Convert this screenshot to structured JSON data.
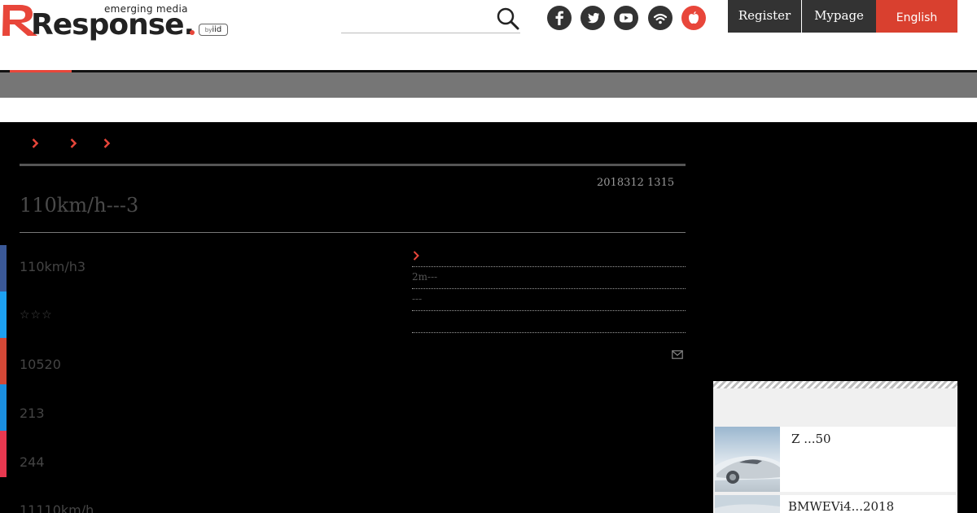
{
  "header": {
    "logo_text": "Response.",
    "logo_tagline": "emerging media",
    "logo_byline_by": "by",
    "logo_byline_brand": "iid",
    "search_placeholder": "",
    "social_icons": [
      "facebook-icon",
      "twitter-icon",
      "youtube-icon",
      "rss-icon",
      "apple-icon"
    ],
    "register_label": "Register",
    "mypage_label": "Mypage",
    "english_label": "English"
  },
  "colors": {
    "accent_red": "#e8463a",
    "button_dark": "#333333",
    "subnav_gray": "#767676",
    "facebook": "#3b5998",
    "twitter": "#1da1f2",
    "google": "#d34836",
    "hatena": "#1b8fe0",
    "pocket": "#e8384f"
  },
  "article": {
    "date": "2018312 1315",
    "title": "110km/h---3",
    "body_lines": [
      "110km/h3",
      "☆☆☆",
      "10520",
      "213",
      "244",
      "11110km/h"
    ]
  },
  "related": {
    "links": [
      "2m---",
      "---"
    ]
  },
  "ranking": {
    "items": [
      {
        "label": "Z ...50"
      },
      {
        "label": "BMWEVi4...2018"
      }
    ]
  }
}
